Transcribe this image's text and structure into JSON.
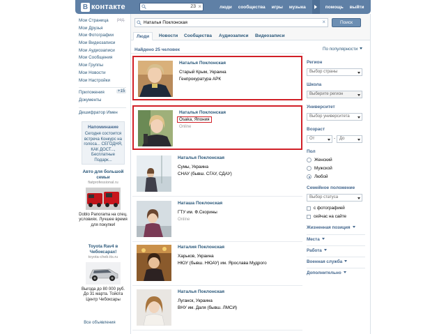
{
  "colors": {
    "brand": "#5f80a6",
    "link": "#2b587a",
    "highlight": "#d11f27"
  },
  "header": {
    "logo_letter": "В",
    "logo_text": "контакте",
    "search_count": "23",
    "search_close": "×",
    "nav": [
      "люди",
      "сообщества",
      "игры",
      "музыка",
      "помощь",
      "выйти"
    ]
  },
  "sidebar": {
    "items": [
      "Мои Страница",
      "Мои Друзья",
      "Мои Фотографии",
      "Мои Видеозаписи",
      "Мои Аудиозаписи",
      "Мои Сообщения",
      "Мои Группы",
      "Мои Новости",
      "Мои Настройки"
    ],
    "edit_label": "ред.",
    "apps_label": "Приложения",
    "apps_badge": "+15",
    "docs_label": "Документы",
    "decoder_label": "Дешифратор Имен"
  },
  "reminder": {
    "title": "Напоминание",
    "text": "Сегодня состоится встреча Конкурс на голоса... СЕГОДНЯ, КАК ДОСТ..., Бесплатные Подарк..."
  },
  "ads": [
    {
      "title": "Авто для большой семьи",
      "domain": "fiatprofessional.ru",
      "text": "Doblo Panorama на спец. условиях. Лучшее время для покупки!"
    },
    {
      "title": "Toyota Rav4 в Чебоксарах!",
      "domain": "toyota-cheb.tts.ru",
      "text": "Выгода до 80 000 руб. До 31 марта. Тойота Центр Чебоксары"
    }
  ],
  "all_ads_label": "Все объявления",
  "search": {
    "query": "Наталья Поклонская",
    "clear": "×",
    "button": "Поиск"
  },
  "tabs": [
    "Люди",
    "Новости",
    "Сообщества",
    "Аудиозаписи",
    "Видеозаписи"
  ],
  "results": {
    "count_label": "Найдено 25 человек",
    "sort_label": "По популярности",
    "items": [
      {
        "name": "Наталья Поклонская",
        "line1": "Старый Крым, Украина",
        "line2": "Генпрокуратура АРК",
        "online": ""
      },
      {
        "name": "Наталья Поклонская",
        "line1": "Ōsaka, Япония",
        "line2": "",
        "online": "Online"
      },
      {
        "name": "Наталья Поклонская",
        "line1": "Сумы, Украина",
        "line2": "СНАУ (бывш. СГАУ, СДАУ)",
        "online": ""
      },
      {
        "name": "Наташа Поклонская",
        "line1": "ГТУ им. Ф.Скорины",
        "line2": "",
        "online": "Online"
      },
      {
        "name": "Наталия Поклонская",
        "line1": "Харьков, Украина",
        "line2": "НЮУ (бывш. НЮАУ) им. Ярослава Мудрого",
        "online": ""
      },
      {
        "name": "Наталья Поклонская",
        "line1": "Луганск, Украина",
        "line2": "ВНУ им. Даля (бывш. ЛМСИ)",
        "online": ""
      }
    ]
  },
  "filters": {
    "region_label": "Регион",
    "country_placeholder": "Выбор страны",
    "school_label": "Школа",
    "school_placeholder": "Выберите регион",
    "university_label": "Университет",
    "university_placeholder": "Выбор университета",
    "age_label": "Возраст",
    "age_from": "От",
    "age_dash": "-",
    "age_to": "До",
    "sex_label": "Пол",
    "sex_options": [
      "Женский",
      "Мужской",
      "Любой"
    ],
    "sex_selected": 2,
    "marital_label": "Семейное положение",
    "marital_placeholder": "Выбор статуса",
    "with_photo": "с фотографией",
    "online_now": "сейчас на сайте",
    "expanders": [
      "Жизненная позиция",
      "Места",
      "Работа",
      "Военная служба",
      "Дополнительно"
    ]
  }
}
